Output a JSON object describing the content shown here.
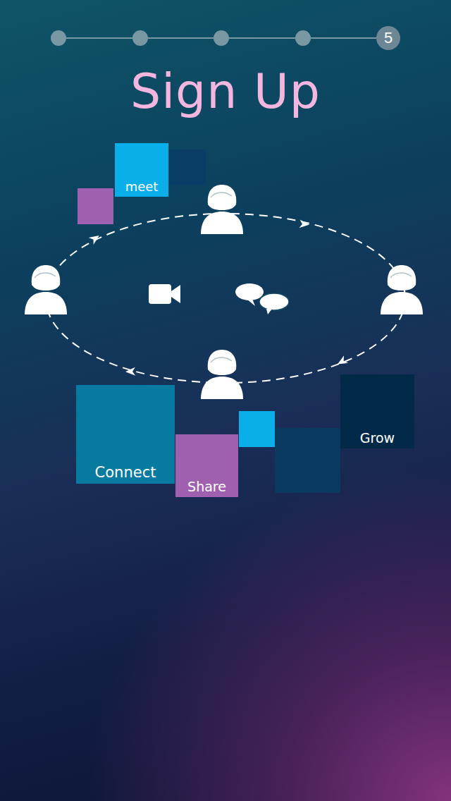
{
  "stepper": {
    "steps": [
      {
        "selected": false
      },
      {
        "selected": false
      },
      {
        "selected": false
      },
      {
        "selected": false
      },
      {
        "selected": true,
        "label": "5"
      }
    ]
  },
  "title": "Sign Up",
  "diagram": {
    "tiles": [
      {
        "label": "meet",
        "color": "#0aaee8"
      },
      {
        "color": "#0a3d66"
      },
      {
        "color": "#a060b0"
      },
      {
        "label": "Connect",
        "color": "#077aa0"
      },
      {
        "label": "Share",
        "color": "#a060b0"
      },
      {
        "color": "#0aaee8"
      },
      {
        "color": "#0a3a60"
      },
      {
        "label": "Grow",
        "color": "#022a48"
      }
    ]
  }
}
